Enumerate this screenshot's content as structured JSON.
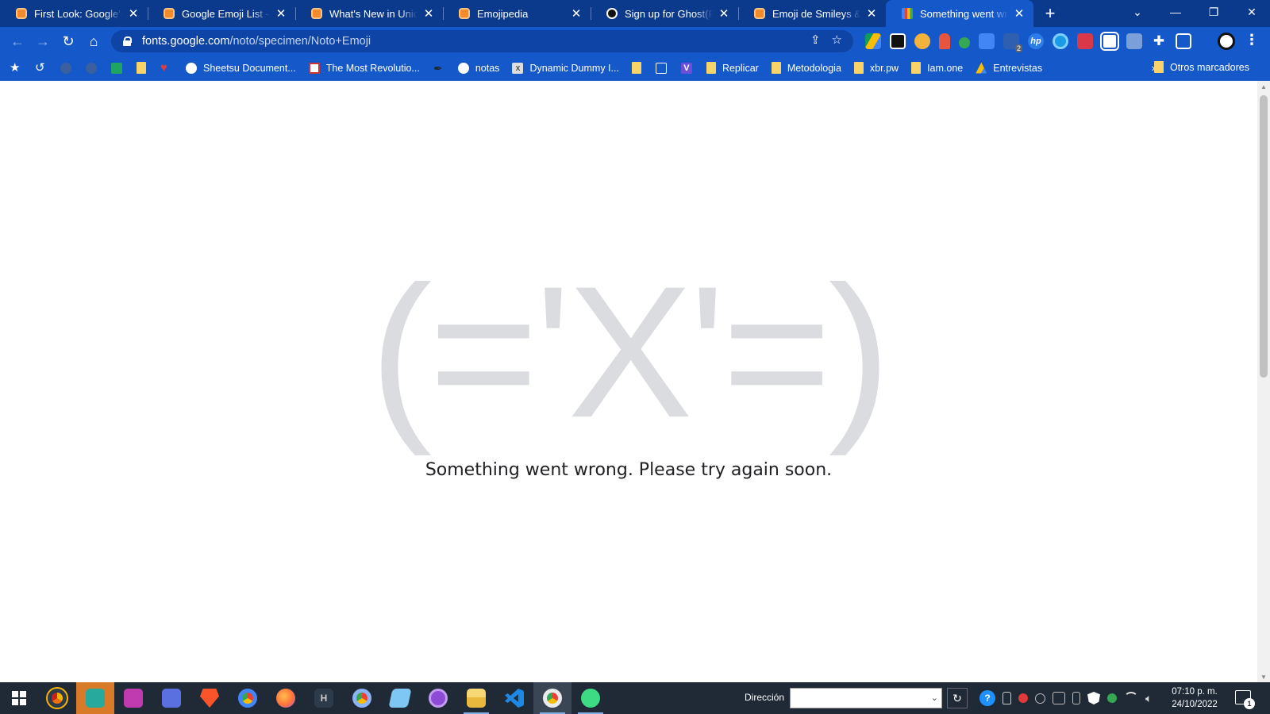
{
  "browser": {
    "tabs": [
      {
        "title": "First Look: Google's Ne",
        "favicon": "emojipedia-icon",
        "active": false
      },
      {
        "title": "Google Emoji List — En",
        "favicon": "emojipedia-icon",
        "active": false
      },
      {
        "title": "What's New in Unicode",
        "favicon": "emojipedia-icon",
        "active": false
      },
      {
        "title": "Emojipedia",
        "favicon": "emojipedia-icon",
        "active": false
      },
      {
        "title": "Sign up for Ghost(Pro)",
        "favicon": "ghost-icon",
        "active": false
      },
      {
        "title": "Emoji de Smileys &",
        "favicon": "smiley-icon",
        "active": false
      },
      {
        "title": "Something went wrong",
        "favicon": "google-fonts-icon",
        "active": true
      }
    ],
    "new_tab": "+",
    "close_glyph": "✕",
    "url": {
      "host": "fonts.google.com",
      "path": "/noto/specimen/Noto+Emoji"
    },
    "bookmarks": [
      {
        "label": "",
        "icon": "star-icon"
      },
      {
        "label": "",
        "icon": "history-icon"
      },
      {
        "label": "",
        "icon": "bookmark-icon"
      },
      {
        "label": "",
        "icon": "bookmark-icon"
      },
      {
        "label": "",
        "icon": "sheets-icon"
      },
      {
        "label": "",
        "icon": "folder-icon"
      },
      {
        "label": "",
        "icon": "heart-icon"
      },
      {
        "label": "Sheetsu Document...",
        "icon": "globe-icon"
      },
      {
        "label": "The Most Revolutio...",
        "icon": "site-icon"
      },
      {
        "label": "",
        "icon": "pen-icon"
      },
      {
        "label": "notas",
        "icon": "globe-icon"
      },
      {
        "label": "Dynamic Dummy I...",
        "icon": "x-icon"
      },
      {
        "label": "",
        "icon": "folder-icon"
      },
      {
        "label": "",
        "icon": "briefcase-icon"
      },
      {
        "label": "",
        "icon": "v-icon"
      },
      {
        "label": "Replicar",
        "icon": "folder-icon"
      },
      {
        "label": "Metodologia",
        "icon": "folder-icon"
      },
      {
        "label": "xbr.pw",
        "icon": "folder-icon"
      },
      {
        "label": "Iam.one",
        "icon": "folder-icon"
      },
      {
        "label": "Entrevistas",
        "icon": "drive-icon"
      }
    ],
    "more_bookmarks": "»",
    "other_bookmarks": "Otros marcadores",
    "extension_badge": "2"
  },
  "page": {
    "kaomoji": "(='X'=)",
    "message": "Something went wrong. Please try again soon."
  },
  "taskbar": {
    "address_label": "Dirección",
    "address_value": "",
    "time": "07:10 p. m.",
    "date": "24/10/2022",
    "notification_count": "1",
    "apps": [
      "chrome-canary-icon",
      "chrome-teal-icon",
      "app-purple-icon",
      "app-blue-icon",
      "brave-icon",
      "chrome-icon",
      "firefox-icon",
      "h-app-icon",
      "chrome-dev-icon",
      "notepad-icon",
      "github-icon",
      "file-explorer-icon",
      "vscode-icon",
      "chrome-active-icon",
      "android-studio-icon"
    ]
  },
  "colors": {
    "frame": "#0b3a8c",
    "toolbar": "#1558c9",
    "kaomoji": "#dadce0",
    "message": "#202124",
    "taskbar": "#1f2a36"
  }
}
